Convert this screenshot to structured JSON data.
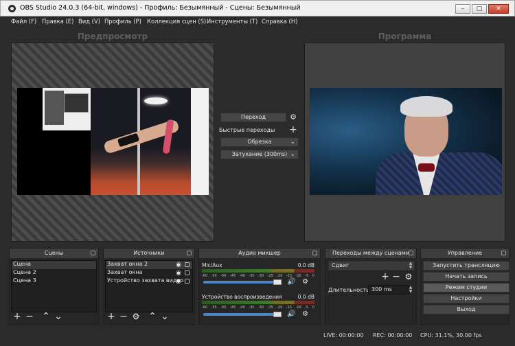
{
  "window": {
    "title": "OBS Studio 24.0.3 (64-bit, windows) - Профиль: Безымянный - Сцены: Безымянный"
  },
  "menu": [
    "Файл (F)",
    "Правка (E)",
    "Вид (V)",
    "Профиль (P)",
    "Коллекция сцен (S)",
    "Инструменты (T)",
    "Справка (H)"
  ],
  "preview": {
    "title": "Предпросмотр"
  },
  "program": {
    "title": "Программа"
  },
  "transition_controls": {
    "transition_button": "Переход",
    "quick_transitions": "Быстрые переходы",
    "cut_button": "Обрезка",
    "fade_select": "Затухание (300ms)"
  },
  "scenes": {
    "title": "Сцены",
    "items": [
      "Сцена",
      "Сцена 2",
      "Сцена 3"
    ]
  },
  "sources": {
    "title": "Источники",
    "items": [
      "Захват окна 2",
      "Захват окна",
      "Устройство захвата видео"
    ]
  },
  "mixer": {
    "title": "Аудио микшер",
    "channels": [
      {
        "name": "Mic/Aux",
        "db": "0.0 dB",
        "volume": 0.92
      },
      {
        "name": "Устройство воспроизведения",
        "db": "0.0 dB",
        "volume": 0.92
      }
    ],
    "scale": [
      "-60",
      "-55",
      "-50",
      "-45",
      "-40",
      "-35",
      "-30",
      "-25",
      "-20",
      "-15",
      "-10",
      "-5",
      "0"
    ]
  },
  "scene_transitions": {
    "title": "Переходы между сценами",
    "selected": "Сдвиг",
    "duration_label": "Длительность",
    "duration_value": "300 ms"
  },
  "controls": {
    "title": "Управление",
    "buttons": [
      "Запустить трансляцию",
      "Начать запись",
      "Режим студии",
      "Настройки",
      "Выход"
    ]
  },
  "status": {
    "live": "LIVE: 00:00:00",
    "rec": "REC: 00:00:00",
    "cpu": "CPU: 31.1%, 30.00 fps"
  },
  "icons": {
    "gear": "gear-icon",
    "plus": "plus-icon",
    "minus": "minus-icon",
    "chevron_up": "chevron-up-icon",
    "chevron_down": "chevron-down-icon",
    "eye": "eye-icon",
    "lock": "lock-icon",
    "speaker": "speaker-icon"
  },
  "colors": {
    "background": "#2b2b2b",
    "dock": "#262626",
    "accent": "#4a86c6"
  }
}
